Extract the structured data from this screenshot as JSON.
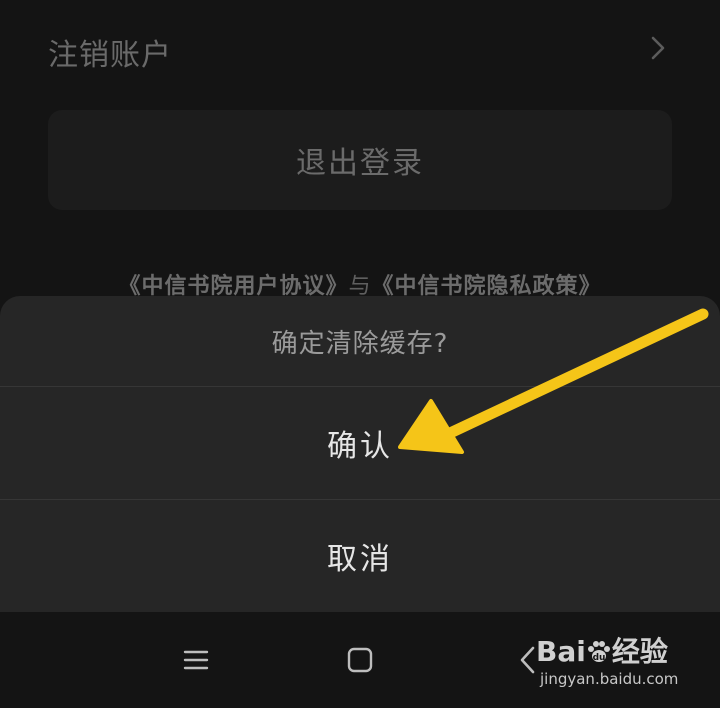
{
  "settings": {
    "deactivate_label": "注销账户",
    "logout_label": "退出登录",
    "agreement_user": "《中信书院用户协议》",
    "agreement_and": "与",
    "agreement_privacy": "《中信书院隐私政策》"
  },
  "dialog": {
    "title": "确定清除缓存?",
    "confirm_label": "确认",
    "cancel_label": "取消"
  },
  "navbar": {
    "icons": [
      "menu-icon",
      "home-icon",
      "back-icon"
    ]
  },
  "watermark": {
    "brand_prefix": "Bai",
    "brand_suffix": "经验",
    "url": "jingyan.baidu.com"
  },
  "colors": {
    "arrow": "#f5c518",
    "sheet_bg": "#262626",
    "page_bg": "#141414"
  }
}
